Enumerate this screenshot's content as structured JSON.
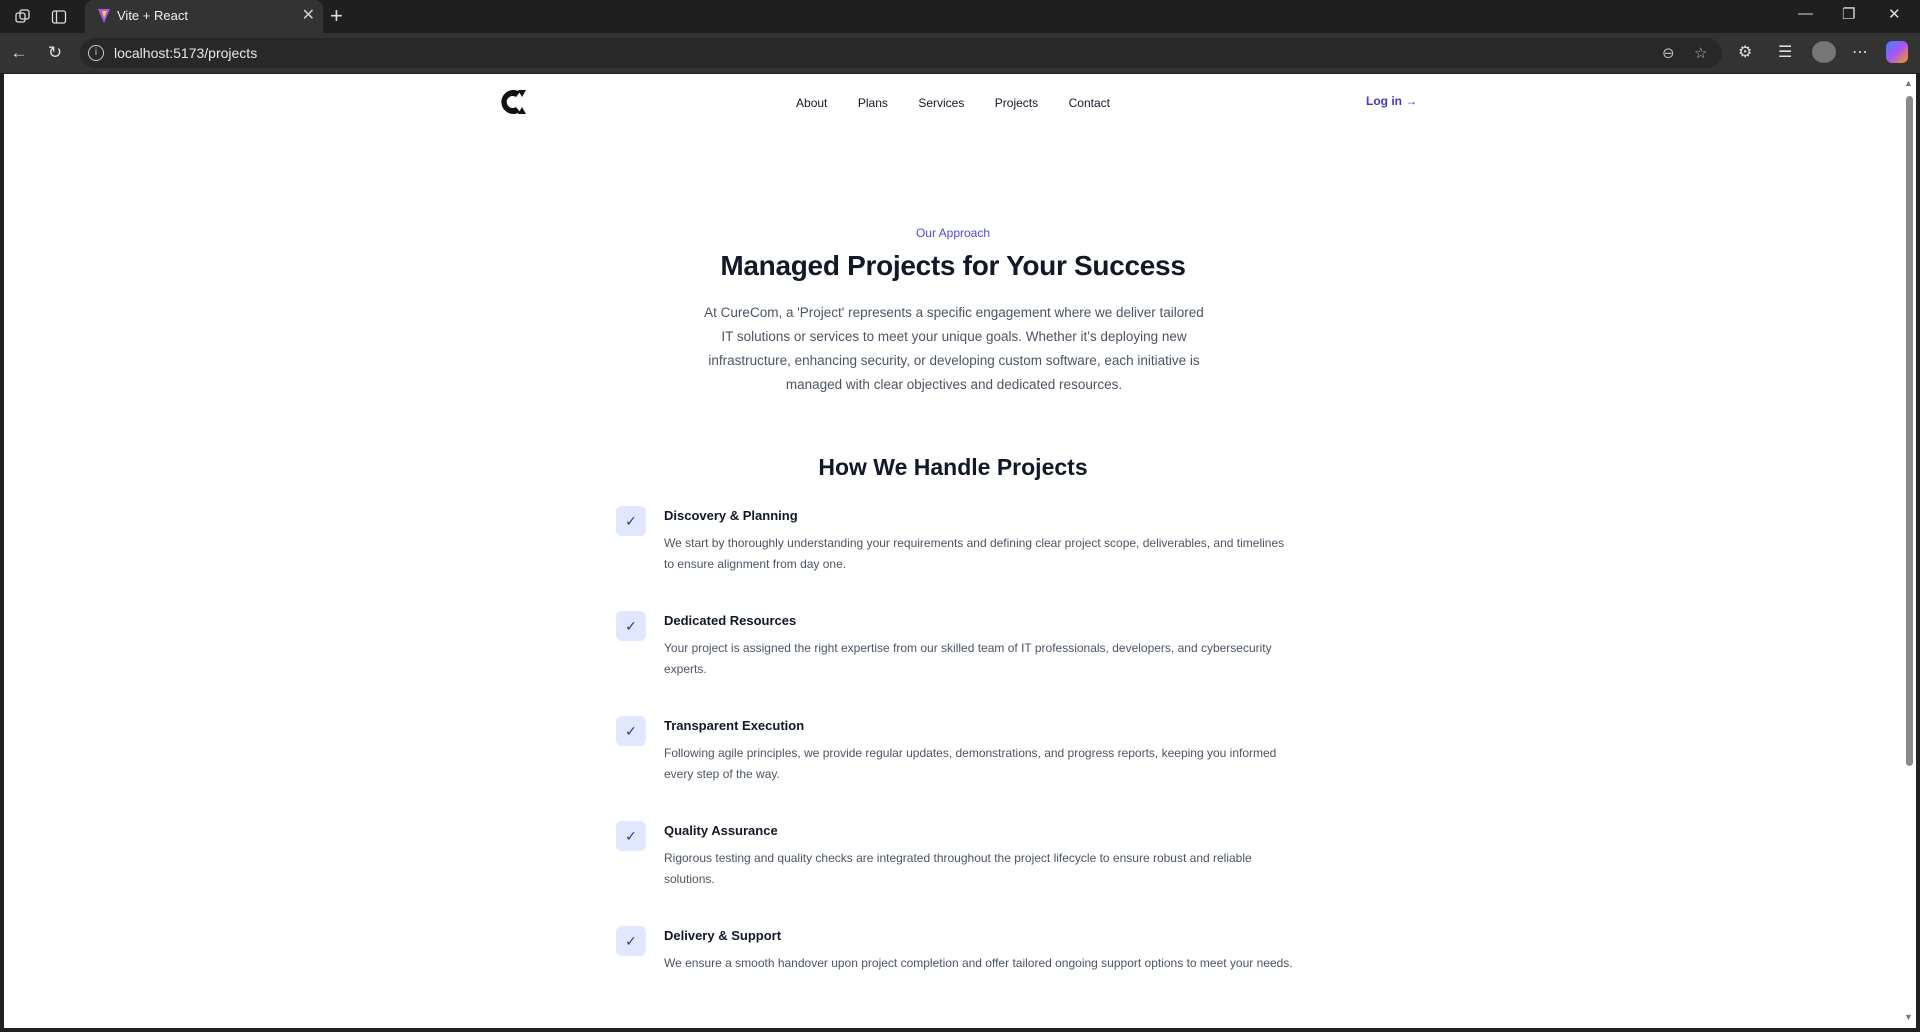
{
  "browser": {
    "tab_title": "Vite + React",
    "url": "localhost:5173/projects"
  },
  "nav": {
    "items": [
      "About",
      "Plans",
      "Services",
      "Projects",
      "Contact"
    ],
    "login": "Log in →"
  },
  "hero": {
    "eyebrow": "Our Approach",
    "title": "Managed Projects for Your Success",
    "intro": "At CureCom, a 'Project' represents a specific engagement where we deliver tailored IT solutions or services to meet your unique goals. Whether it's deploying new infrastructure, enhancing security, or developing custom software, each initiative is managed with clear objectives and dedicated resources."
  },
  "process": {
    "title": "How We Handle Projects",
    "steps": [
      {
        "title": "Discovery & Planning",
        "desc": "We start by thoroughly understanding your requirements and defining clear project scope, deliverables, and timelines to ensure alignment from day one."
      },
      {
        "title": "Dedicated Resources",
        "desc": "Your project is assigned the right expertise from our skilled team of IT professionals, developers, and cybersecurity experts."
      },
      {
        "title": "Transparent Execution",
        "desc": "Following agile principles, we provide regular updates, demonstrations, and progress reports, keeping you informed every step of the way."
      },
      {
        "title": "Quality Assurance",
        "desc": "Rigorous testing and quality checks are integrated throughout the project lifecycle to ensure robust and reliable solutions."
      },
      {
        "title": "Delivery & Support",
        "desc": "We ensure a smooth handover upon project completion and offer tailored ongoing support options to meet your needs."
      }
    ]
  },
  "colors": {
    "accent": "#4f46e5",
    "check_bg": "#e0e7ff"
  }
}
